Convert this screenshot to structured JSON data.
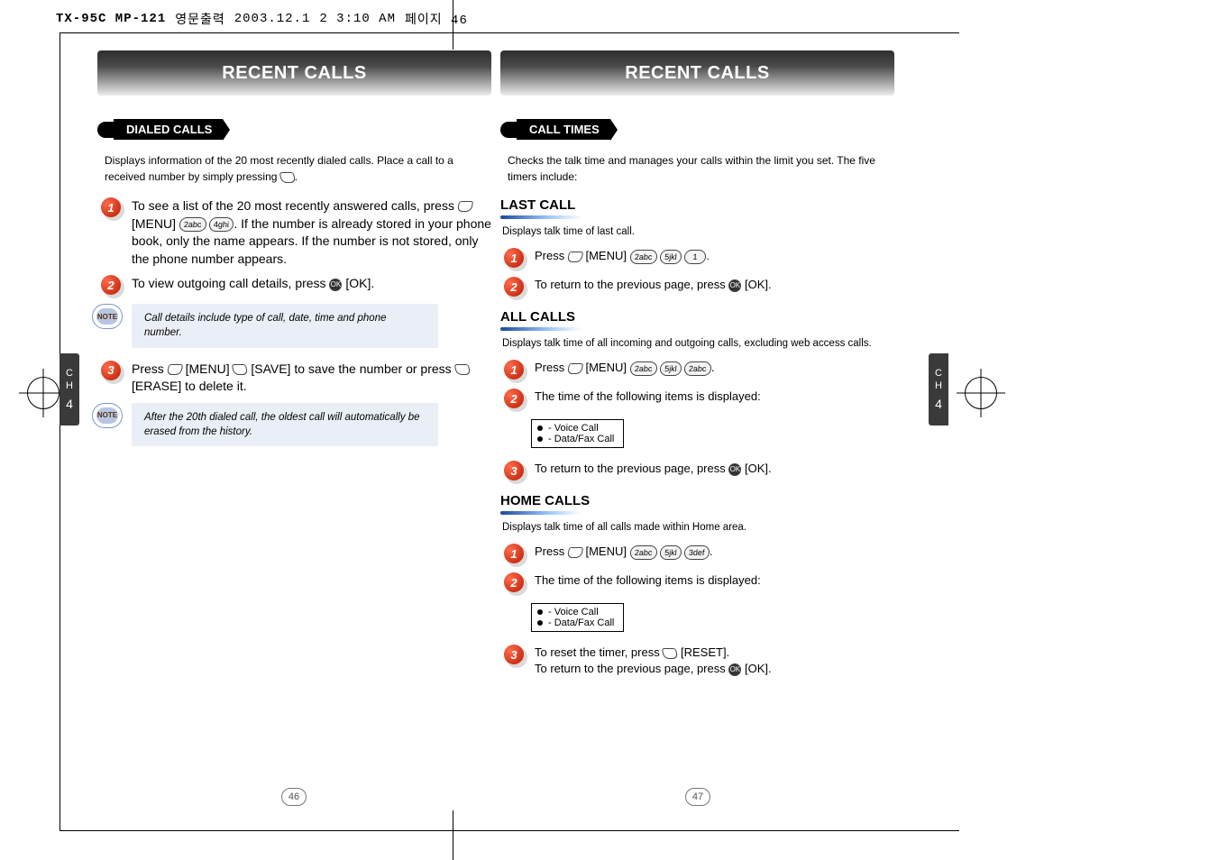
{
  "crop": {
    "file": "TX-95C MP-121",
    "ko": "영문출력",
    "date": "2003.12.1",
    "time": "2 3:10 AM",
    "page": "페이지 46"
  },
  "side": {
    "ch": "C\nH",
    "num": "4"
  },
  "pages": {
    "left": {
      "title": "RECENT CALLS",
      "pill": "DIALED CALLS",
      "intro": "Displays information of the 20 most recently dialed calls. Place a call to a received number by simply pressing",
      "step1": "To see a list of the 20 most recently answered calls, press",
      "step1_menu": "[MENU]",
      "step1_b": ". If the number is already stored in your phone book, only the name appears. If the number is not stored, only the phone number appears.",
      "step2": "To view outgoing call details, press",
      "step2_ok": "[OK].",
      "note1": "Call details include type of call, date, time and phone number.",
      "step3a": "Press",
      "step3_menu": "[MENU]",
      "step3_save": "[SAVE] to save the number or press",
      "step3_erase": "[ERASE] to delete it.",
      "note2": "After the 20th dialed call, the oldest call will automatically be erased from the history.",
      "pageno": "46"
    },
    "right": {
      "title": "RECENT CALLS",
      "pill": "CALL TIMES",
      "intro": "Checks the talk time and manages your calls within the limit you set. The five timers include:",
      "last": {
        "head": "LAST CALL",
        "desc": "Displays talk time of last call.",
        "s1": "Press",
        "s1_menu": "[MENU]",
        "s2": "To return to the previous page, press",
        "s2_ok": "[OK]."
      },
      "all": {
        "head": "ALL CALLS",
        "desc": "Displays talk time of all incoming and outgoing calls, excluding web access calls.",
        "s1": "Press",
        "s1_menu": "[MENU]",
        "s2": "The time of the following items is displayed:",
        "b1": "- Voice Call",
        "b2": "- Data/Fax Call",
        "s3": "To return to the previous page, press",
        "s3_ok": "[OK]."
      },
      "home": {
        "head": "HOME CALLS",
        "desc": "Displays talk time of all calls made within Home area.",
        "s1": "Press",
        "s1_menu": "[MENU]",
        "s2": "The time of the following items is displayed:",
        "b1": "- Voice Call",
        "b2": "- Data/Fax Call",
        "s3a": "To reset the timer, press",
        "s3_reset": "[RESET].",
        "s3b": "To return to the previous page, press",
        "s3_ok": "[OK]."
      },
      "pageno": "47"
    }
  },
  "keys": {
    "k2": "2abc",
    "k4": "4ghi",
    "k5": "5jkl",
    "k1": "1",
    "ok": "OK"
  }
}
